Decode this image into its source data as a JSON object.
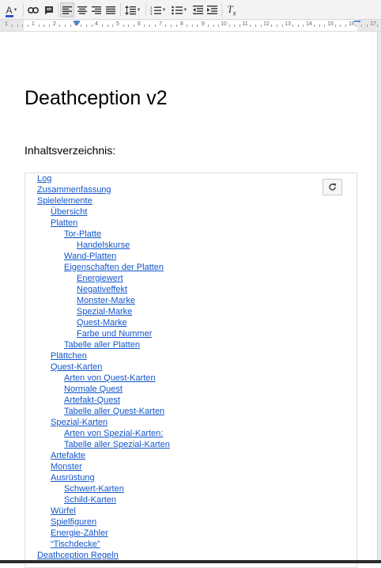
{
  "toolbar": {
    "buttons": [
      {
        "name": "text-color-icon"
      },
      {
        "name": "link-icon"
      },
      {
        "name": "comment-icon"
      },
      {
        "name": "align-left-icon",
        "pressed": true
      },
      {
        "name": "align-center-icon"
      },
      {
        "name": "align-right-icon"
      },
      {
        "name": "justify-icon"
      },
      {
        "name": "line-spacing-icon"
      },
      {
        "name": "numbered-list-icon"
      },
      {
        "name": "bulleted-list-icon"
      },
      {
        "name": "decrease-indent-icon"
      },
      {
        "name": "increase-indent-icon"
      },
      {
        "name": "clear-formatting-icon"
      }
    ],
    "text_color_glyph": "A",
    "clear_formatting_glyph": "T",
    "clear_formatting_sub": "x",
    "accent_color": "#3355cc"
  },
  "ruler": {
    "numbers": [
      "1",
      "1",
      "2",
      "3",
      "4",
      "5",
      "6",
      "7",
      "8",
      "9",
      "10",
      "11",
      "12",
      "13",
      "14",
      "15",
      "16",
      "17"
    ]
  },
  "document": {
    "title": "Deathception v2",
    "toc_heading": "Inhaltsverzeichnis:",
    "toc_refresh_icon": "refresh-icon",
    "link_color": "#1155cc",
    "toc": [
      {
        "text": "Log",
        "level": 0
      },
      {
        "text": "Zusammenfassung",
        "level": 0
      },
      {
        "text": "Spielelemente",
        "level": 0
      },
      {
        "text": "Übersicht",
        "level": 1
      },
      {
        "text": "Platten",
        "level": 1
      },
      {
        "text": "Tor-Platte",
        "level": 2
      },
      {
        "text": "Handelskurse",
        "level": 3
      },
      {
        "text": "Wand-Platten",
        "level": 2
      },
      {
        "text": "Eigenschaften der Platten",
        "level": 2
      },
      {
        "text": "Energiewert",
        "level": 3
      },
      {
        "text": "Negativeffekt",
        "level": 3
      },
      {
        "text": "Monster-Marke",
        "level": 3
      },
      {
        "text": "Spezial-Marke",
        "level": 3
      },
      {
        "text": "Quest-Marke",
        "level": 3
      },
      {
        "text": "Farbe und Nummer",
        "level": 3
      },
      {
        "text": "Tabelle aller Platten",
        "level": 2
      },
      {
        "text": "Plättchen",
        "level": 1
      },
      {
        "text": "Quest-Karten",
        "level": 1
      },
      {
        "text": "Arten von Quest-Karten",
        "level": 2
      },
      {
        "text": "Normale Quest",
        "level": 2
      },
      {
        "text": "Artefakt-Quest",
        "level": 2
      },
      {
        "text": "Tabelle aller Quest-Karten",
        "level": 2
      },
      {
        "text": "Spezial-Karten",
        "level": 1
      },
      {
        "text": "Arten von Spezial-Karten:",
        "level": 2
      },
      {
        "text": "Tabelle aller Spezial-Karten",
        "level": 2
      },
      {
        "text": "Artefakte",
        "level": 1
      },
      {
        "text": "Monster",
        "level": 1
      },
      {
        "text": "Ausrüstung",
        "level": 1
      },
      {
        "text": "Schwert-Karten",
        "level": 2
      },
      {
        "text": "Schild-Karten",
        "level": 2
      },
      {
        "text": "Würfel",
        "level": 1
      },
      {
        "text": "Spielfiguren",
        "level": 1
      },
      {
        "text": "Energie-Zähler",
        "level": 1
      },
      {
        "text": "“Tischdecke”",
        "level": 1
      },
      {
        "text": "Deathception Regeln",
        "level": 0
      }
    ]
  }
}
